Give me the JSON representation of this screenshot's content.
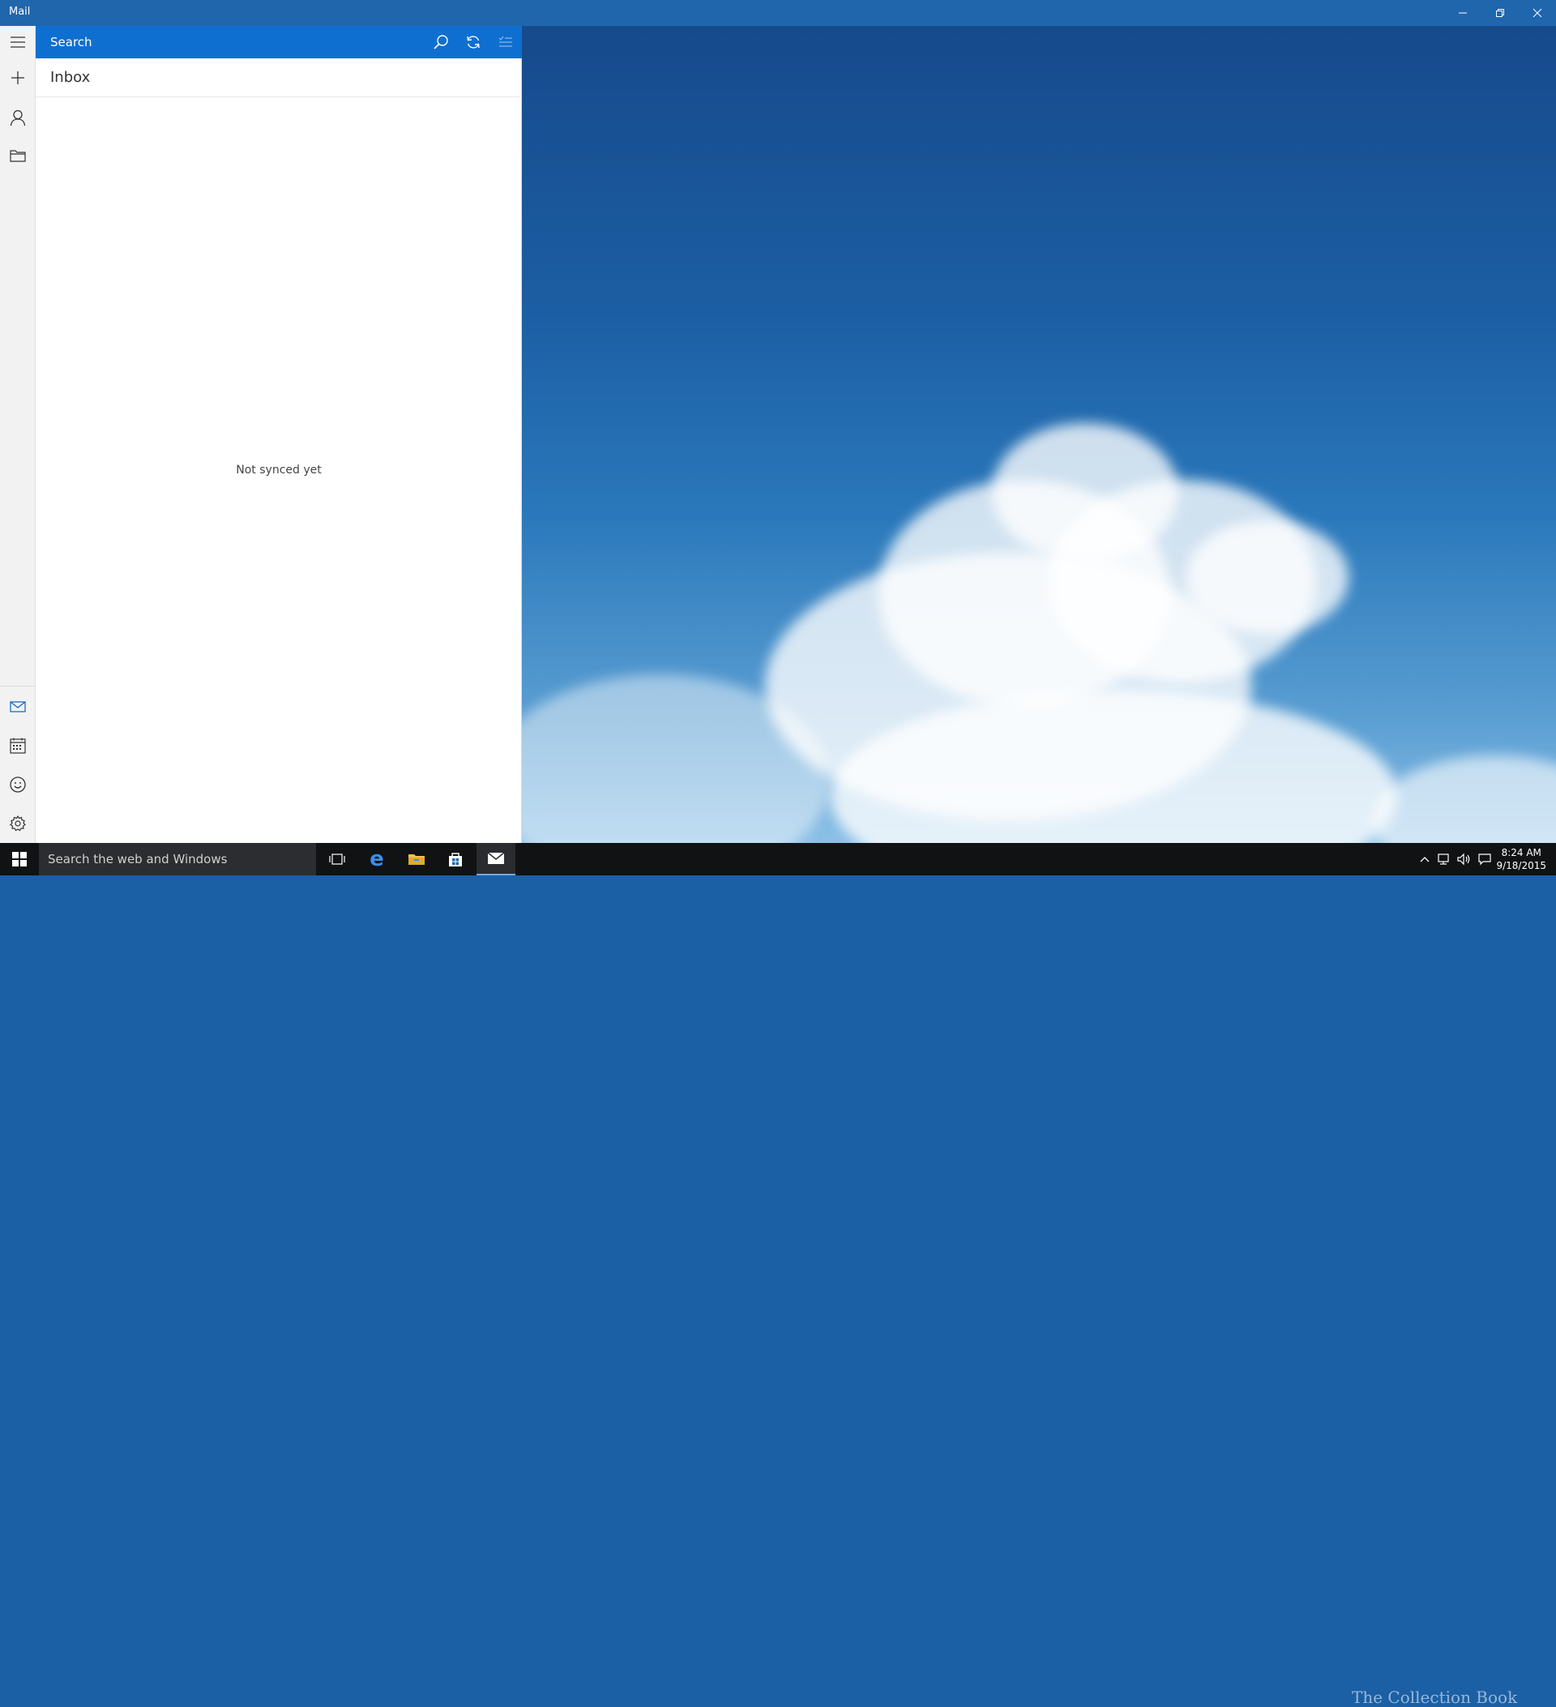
{
  "window": {
    "title": "Mail"
  },
  "search": {
    "placeholder": "Search"
  },
  "folder": {
    "name": "Inbox",
    "empty_message": "Not synced yet"
  },
  "taskbar": {
    "search_placeholder": "Search the web and Windows",
    "clock_time": "8:24 AM",
    "clock_date": "9/18/2015"
  },
  "watermark": {
    "text": "The Collection Book"
  },
  "colors": {
    "titlebar": "#1f66ad",
    "searchbar": "#0f6fd0",
    "rail": "#f2f2f2",
    "taskbar": "#101214",
    "accent": "#0f6fd0"
  },
  "icons": {
    "rail_top": [
      "hamburger-menu-icon",
      "new-mail-icon",
      "accounts-icon",
      "folders-icon"
    ],
    "rail_bottom": [
      "mail-icon",
      "calendar-icon",
      "feedback-smiley-icon",
      "settings-gear-icon"
    ],
    "search_bar": [
      "search-icon",
      "sync-icon",
      "select-mode-icon"
    ],
    "taskbar": [
      "windows-start-icon",
      "task-view-icon",
      "edge-icon",
      "file-explorer-icon",
      "store-icon",
      "mail-app-icon"
    ]
  }
}
